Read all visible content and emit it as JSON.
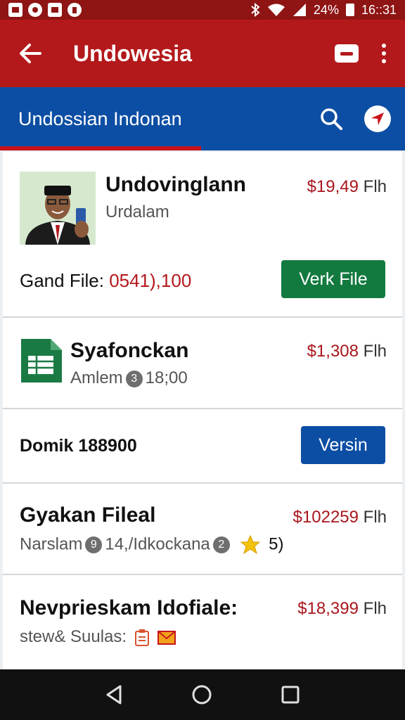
{
  "status_bar": {
    "battery": "24%",
    "time": "16::31",
    "icons": [
      "gallery-icon",
      "camera-icon",
      "image-icon",
      "lock-app-icon",
      "bluetooth-icon",
      "wifi-icon",
      "signal-icon",
      "battery-icon"
    ]
  },
  "app_bar": {
    "title": "Undowesia",
    "icons": [
      "back-arrow-icon",
      "card-icon",
      "more-vert-icon"
    ]
  },
  "search_bar": {
    "text": "Undossian Indonan",
    "icons": [
      "search-icon",
      "navigation-icon"
    ]
  },
  "items": [
    {
      "title": "Undovinglann",
      "subtitle": "Urdalam",
      "price": "$19,49",
      "unit": "Flh",
      "file_label": "Gand File:",
      "file_value": "0541),100",
      "button": "Verk File"
    },
    {
      "title": "Syafonckan",
      "subtitle": "Amlem",
      "badge": "3",
      "time": "18;00",
      "price": "$1,308",
      "unit": "Flh"
    },
    {
      "title": "Domik 188900",
      "button": "Versin"
    },
    {
      "title": "Gyakan Fileal",
      "subtitle": "Narslam",
      "badge1": "9",
      "mid": "14,/Idkockana",
      "badge2": "2",
      "rating": "5)",
      "price": "$102259",
      "unit": "Flh"
    },
    {
      "title": "Nevprieskam Idofiale:",
      "subtitle": "stew& Suulas:",
      "price": "$18,399",
      "unit": "Flh"
    }
  ],
  "colors": {
    "status_bar": "#8f1414",
    "app_bar": "#b3191b",
    "search_bar": "#0c4ea3",
    "green_button": "#137a3f",
    "blue_button": "#0c4ea3",
    "price": "#a8161c"
  }
}
